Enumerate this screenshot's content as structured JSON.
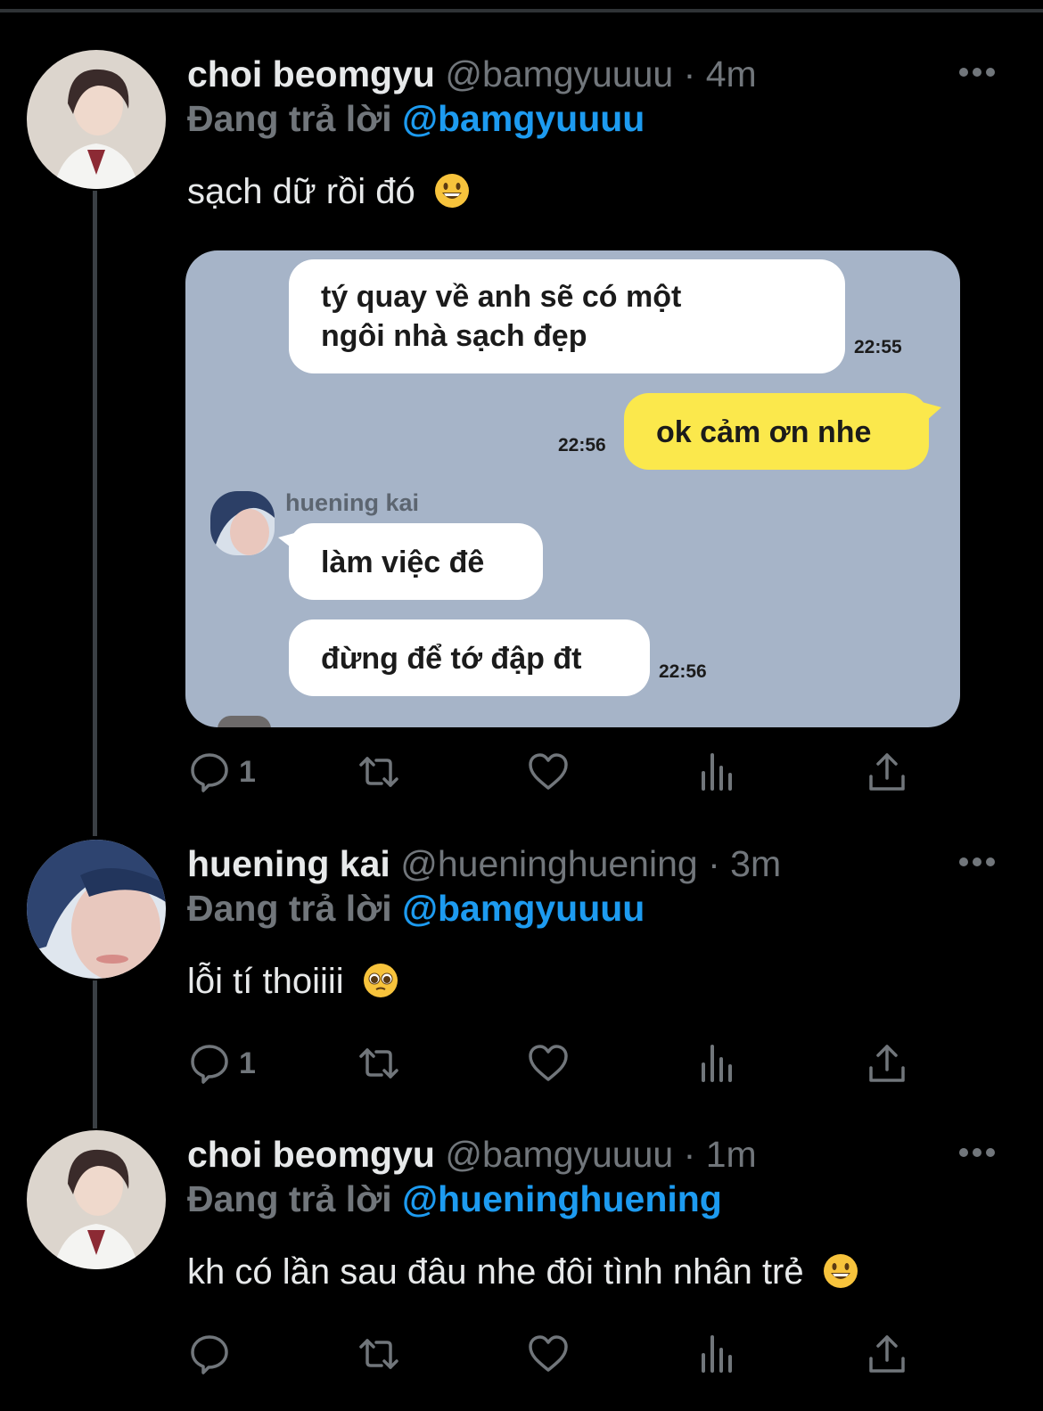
{
  "tweets": [
    {
      "name": "choi beomgyu",
      "handle": "@bamgyuuuu",
      "separator": "·",
      "time": "4m",
      "reply_label": "Đang trả lời",
      "reply_to": "@bamgyuuuu",
      "text": "sạch dữ rồi đó",
      "emoji": "grinning-face",
      "replies": "1",
      "media": {
        "messages": [
          {
            "line1": "tý quay về anh sẽ có một",
            "line2": "ngôi nhà sạch đẹp",
            "time": "22:55"
          },
          {
            "text": "ok cảm ơn nhe",
            "time": "22:56"
          },
          {
            "sender": "huening kai",
            "text": "làm việc đê"
          },
          {
            "text": "đừng để tớ đập đt",
            "time": "22:56"
          }
        ]
      }
    },
    {
      "name": "huening kai",
      "handle": "@hueninghuening",
      "separator": "·",
      "time": "3m",
      "reply_label": "Đang trả lời",
      "reply_to": "@bamgyuuuu",
      "text": "lỗi tí thoiiii",
      "emoji": "pleading-face",
      "replies": "1"
    },
    {
      "name": "choi beomgyu",
      "handle": "@bamgyuuuu",
      "separator": "·",
      "time": "1m",
      "reply_label": "Đang trả lời",
      "reply_to": "@hueninghuening",
      "text": "kh có lần sau đâu nhe đôi tình nhân trẻ",
      "emoji": "grinning-face",
      "replies": ""
    }
  ],
  "colors": {
    "background": "#000000",
    "text": "#e7e9ea",
    "secondary": "#71767b",
    "mention": "#1d9bf0",
    "chat_bg": "#a6b4c8",
    "chat_yellow": "#fbe84c"
  }
}
